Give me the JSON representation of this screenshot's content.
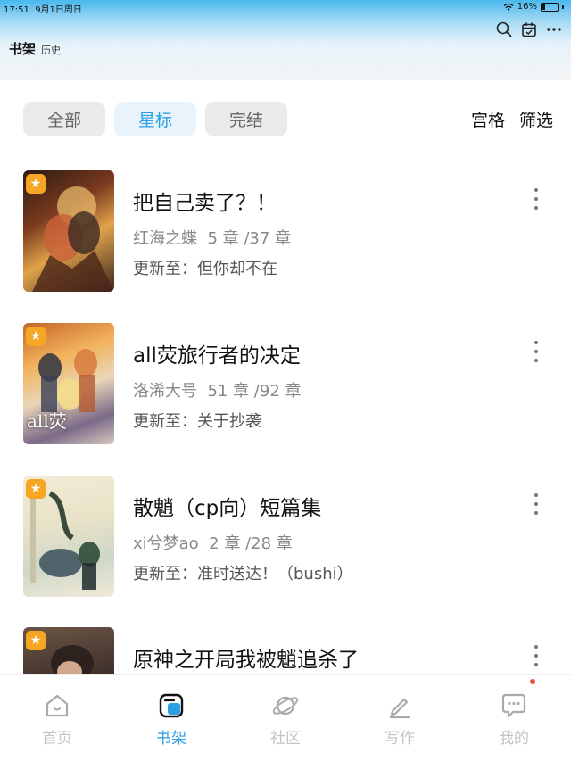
{
  "status_bar": {
    "time": "17:51",
    "date": "9月1日周日",
    "battery": "16%"
  },
  "header": {
    "title": "书架",
    "subtitle": "历史",
    "icons": [
      "search-icon",
      "calendar-icon",
      "more-icon"
    ]
  },
  "filters": {
    "tabs": [
      "全部",
      "星标",
      "完结"
    ],
    "active_index": 1,
    "grid_label": "宫格",
    "filter_label": "筛选"
  },
  "books": [
    {
      "title": "把自己卖了？！",
      "author": "红海之蝶",
      "progress": "5 章 /37 章",
      "update_prefix": "更新至：",
      "update": "但你却不在",
      "starred": true
    },
    {
      "title": "all荧旅行者的决定",
      "author": "洛浠大号",
      "progress": "51 章 /92 章",
      "update_prefix": "更新至：",
      "update": "关于抄袭",
      "cover_text": "all荧",
      "starred": true
    },
    {
      "title": "散魈（cp向）短篇集",
      "author": "xi兮梦ao",
      "progress": "2 章 /28 章",
      "update_prefix": "更新至：",
      "update": "准时送达！（bushi）",
      "starred": true
    },
    {
      "title": "原神之开局我被魈追杀了",
      "author": "",
      "progress": "",
      "update_prefix": "",
      "update": "",
      "starred": true
    }
  ],
  "bottom_nav": [
    {
      "label": "首页",
      "icon": "home-icon",
      "active": false
    },
    {
      "label": "书架",
      "icon": "bookshelf-icon",
      "active": true
    },
    {
      "label": "社区",
      "icon": "planet-icon",
      "active": false
    },
    {
      "label": "写作",
      "icon": "pen-icon",
      "active": false
    },
    {
      "label": "我的",
      "icon": "chat-icon",
      "active": false,
      "badge_dot": true
    }
  ],
  "colors": {
    "accent": "#2c9ee5",
    "star": "#f6a623",
    "badge": "#e8533c"
  }
}
